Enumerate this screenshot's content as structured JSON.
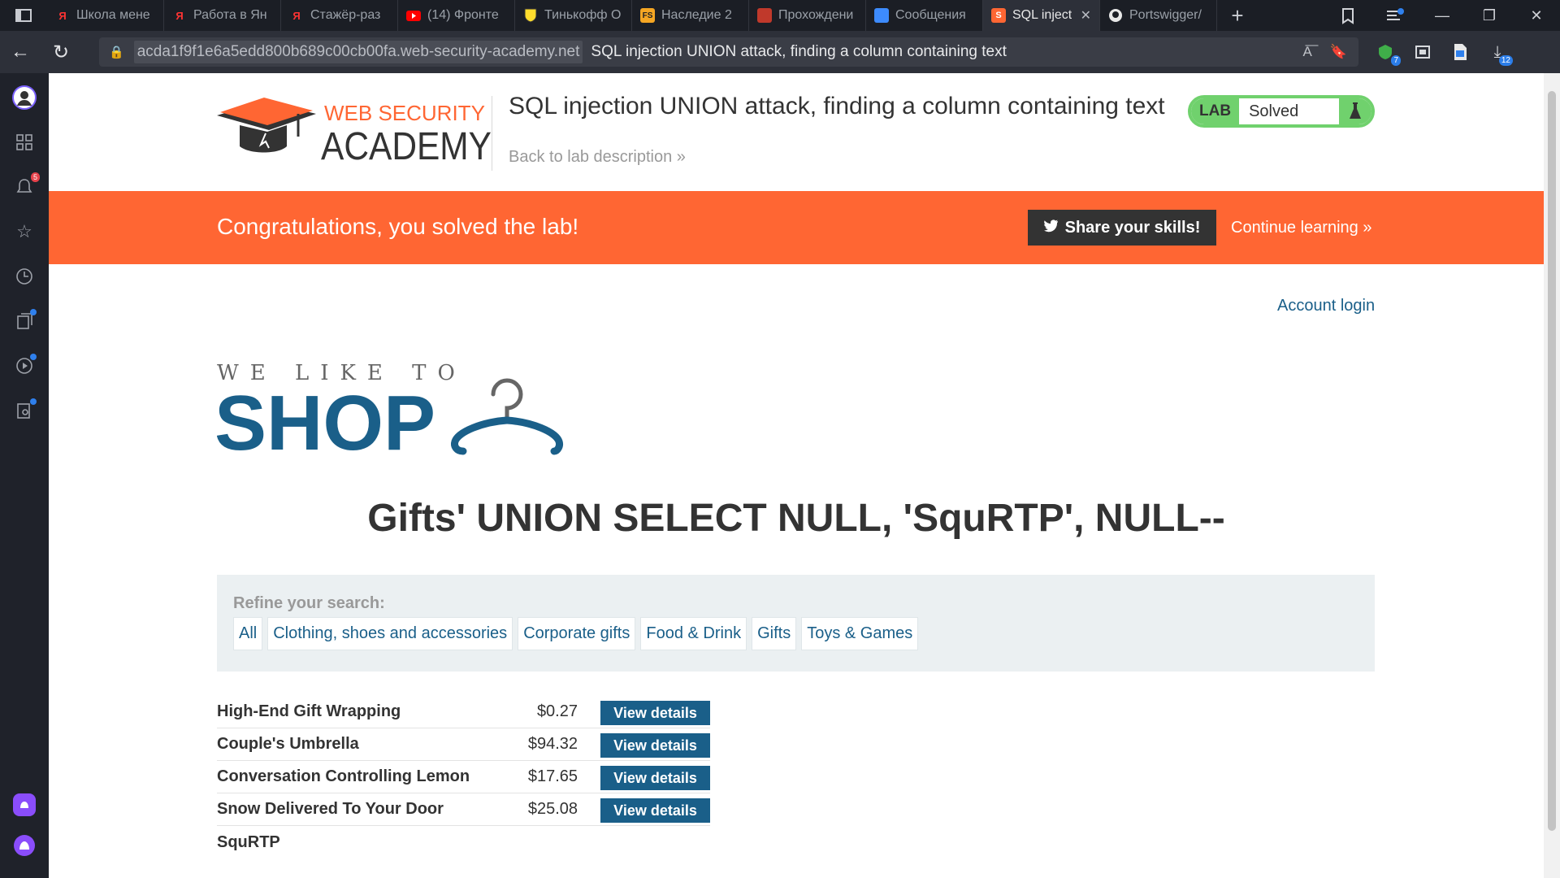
{
  "browser": {
    "tabs": [
      {
        "title": "Школа мене",
        "icon": "yandex-icon",
        "active": false
      },
      {
        "title": "Работа в Ян",
        "icon": "yandex-icon",
        "active": false
      },
      {
        "title": "Стажёр-раз",
        "icon": "yandex-icon",
        "active": false
      },
      {
        "title": "(14) Фронте",
        "icon": "youtube-icon",
        "active": false
      },
      {
        "title": "Тинькофф О",
        "icon": "tinkoff-icon",
        "active": false
      },
      {
        "title": "Наследие 2",
        "icon": "fs-icon",
        "active": false
      },
      {
        "title": "Прохождени",
        "icon": "game-icon",
        "active": false
      },
      {
        "title": "Сообщения",
        "icon": "messages-icon",
        "active": false
      },
      {
        "title": "SQL inject",
        "icon": "portswigger-icon",
        "active": true
      },
      {
        "title": "Portswigger/",
        "icon": "github-icon",
        "active": false
      }
    ],
    "url_host": "acda1f9f1e6a5edd800b689c00cb00fa.web-security-academy.net",
    "page_title": "SQL injection UNION attack, finding a column containing text",
    "downloads_badge": "12",
    "extension_badge": "7",
    "notifications_badge": "5"
  },
  "academy": {
    "logo_top": "WEB SECURITY",
    "logo_bottom": "ACADEMY",
    "lab_title": "SQL injection UNION attack, finding a column containing text",
    "back_link": "Back to lab description",
    "lab_label": "LAB",
    "lab_status": "Solved"
  },
  "banner": {
    "message": "Congratulations, you solved the lab!",
    "share_label": "Share your skills!",
    "continue_label": "Continue learning"
  },
  "shop": {
    "account_login": "Account login",
    "logo_tagline": "WE LIKE TO",
    "logo_word": "SHOP",
    "search_title": "Gifts' UNION SELECT NULL, 'SquRTP', NULL--",
    "refine_label": "Refine your search:",
    "categories": [
      "All",
      "Clothing, shoes and accessories",
      "Corporate gifts",
      "Food & Drink",
      "Gifts",
      "Toys & Games"
    ],
    "products": [
      {
        "name": "High-End Gift Wrapping",
        "price": "$0.27",
        "button": "View details"
      },
      {
        "name": "Couple's Umbrella",
        "price": "$94.32",
        "button": "View details"
      },
      {
        "name": "Conversation Controlling Lemon",
        "price": "$17.65",
        "button": "View details"
      },
      {
        "name": "Snow Delivered To Your Door",
        "price": "$25.08",
        "button": "View details"
      },
      {
        "name": "SquRTP",
        "price": "",
        "button": ""
      }
    ]
  },
  "colors": {
    "accent_orange": "#ff6633",
    "shop_blue": "#1a5f89",
    "solved_green": "#70d16d"
  }
}
